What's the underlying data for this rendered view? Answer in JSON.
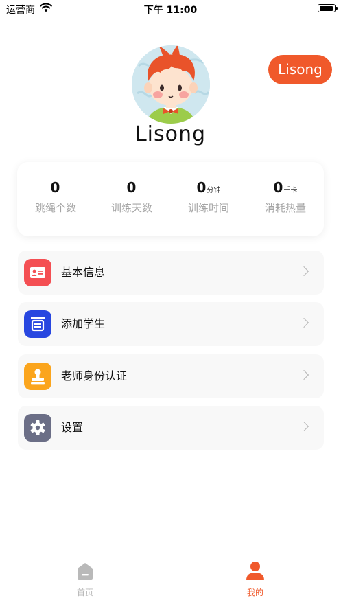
{
  "status_bar": {
    "carrier": "运营商",
    "time": "下午 11:00"
  },
  "profile": {
    "username": "Lisong",
    "name_button": "Lisong"
  },
  "stats": [
    {
      "value": "0",
      "unit": "",
      "label": "跳绳个数"
    },
    {
      "value": "0",
      "unit": "",
      "label": "训练天数"
    },
    {
      "value": "0",
      "unit": "分钟",
      "label": "训练时间"
    },
    {
      "value": "0",
      "unit": "千卡",
      "label": "消耗热量"
    }
  ],
  "menu": [
    {
      "label": "基本信息",
      "icon": "id-card-icon",
      "color": "#f44f53"
    },
    {
      "label": "添加学生",
      "icon": "add-student-icon",
      "color": "#2847e0"
    },
    {
      "label": "老师身份认证",
      "icon": "certification-stamp-icon",
      "color": "#fba51d"
    },
    {
      "label": "设置",
      "icon": "gear-icon",
      "color": "#6b6e86"
    }
  ],
  "tabbar": {
    "items": [
      {
        "label": "首页",
        "icon": "home-icon",
        "active": false
      },
      {
        "label": "我的",
        "icon": "person-icon",
        "active": true
      }
    ],
    "active_color": "#f0592b",
    "inactive_color": "#b9b9b9"
  }
}
